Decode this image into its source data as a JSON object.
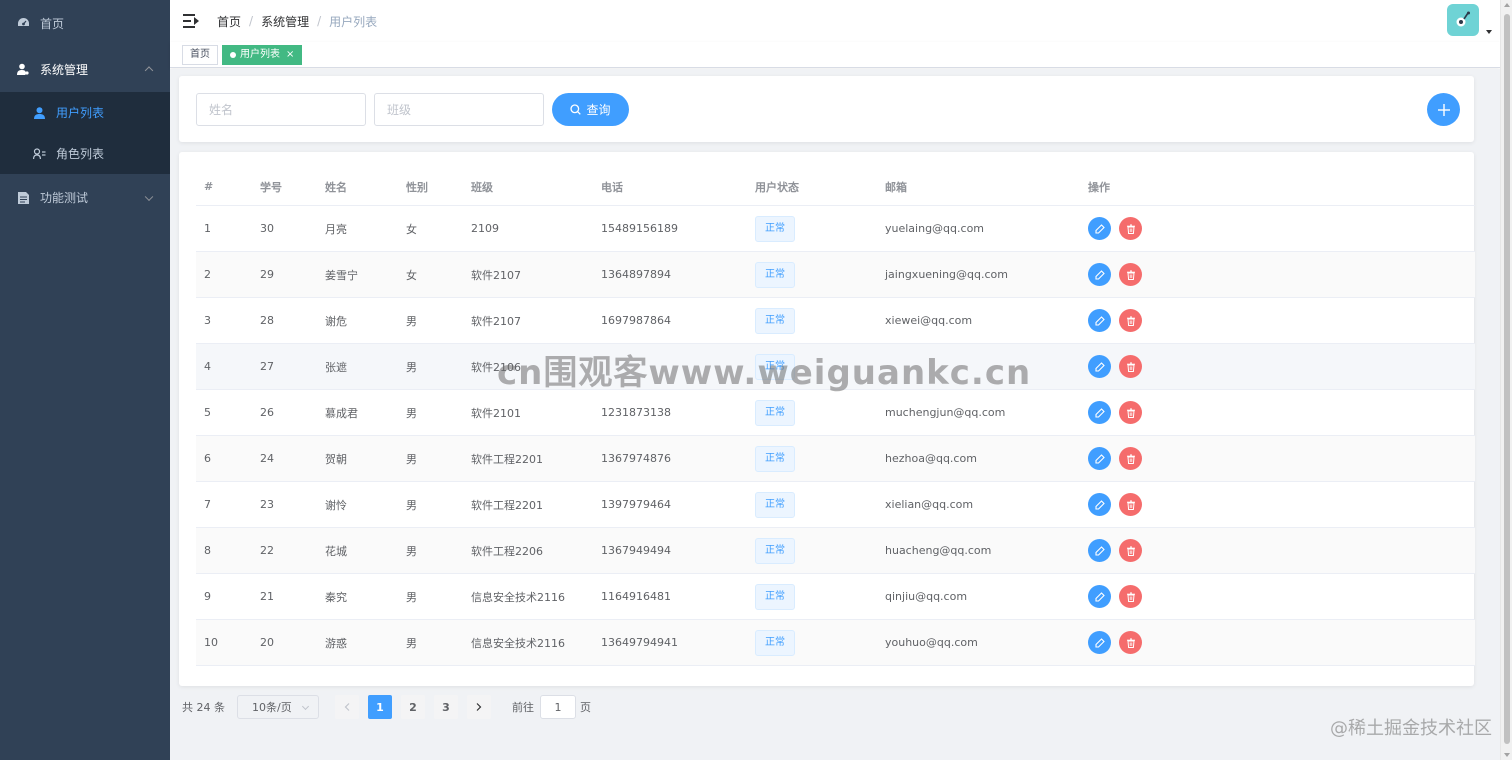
{
  "sidebar": {
    "items": [
      {
        "label": "首页",
        "icon": "dashboard-icon"
      },
      {
        "label": "系统管理",
        "icon": "user-settings-icon",
        "expanded": true,
        "children": [
          {
            "label": "用户列表",
            "icon": "user-icon",
            "active": true
          },
          {
            "label": "角色列表",
            "icon": "role-icon"
          }
        ]
      },
      {
        "label": "功能测试",
        "icon": "document-icon",
        "expanded": false
      }
    ]
  },
  "header": {
    "breadcrumb": [
      "首页",
      "系统管理",
      "用户列表"
    ]
  },
  "tags": {
    "home": "首页",
    "active": "用户列表",
    "close": "×"
  },
  "search": {
    "name_placeholder": "姓名",
    "class_placeholder": "班级",
    "query_label": "查询"
  },
  "table": {
    "columns": [
      "#",
      "学号",
      "姓名",
      "性别",
      "班级",
      "电话",
      "用户状态",
      "邮箱",
      "操作"
    ],
    "rows": [
      {
        "idx": "1",
        "sid": "30",
        "name": "月亮",
        "gender": "女",
        "class": "2109",
        "phone": "15489156189",
        "status": "正常",
        "email": "yuelaing@qq.com"
      },
      {
        "idx": "2",
        "sid": "29",
        "name": "姜雪宁",
        "gender": "女",
        "class": "软件2107",
        "phone": "1364897894",
        "status": "正常",
        "email": "jaingxuening@qq.com"
      },
      {
        "idx": "3",
        "sid": "28",
        "name": "谢危",
        "gender": "男",
        "class": "软件2107",
        "phone": "1697987864",
        "status": "正常",
        "email": "xiewei@qq.com"
      },
      {
        "idx": "4",
        "sid": "27",
        "name": "张遮",
        "gender": "男",
        "class": "软件2106",
        "phone": "",
        "status": "正常",
        "email": ""
      },
      {
        "idx": "5",
        "sid": "26",
        "name": "慕成君",
        "gender": "男",
        "class": "软件2101",
        "phone": "1231873138",
        "status": "正常",
        "email": "muchengjun@qq.com"
      },
      {
        "idx": "6",
        "sid": "24",
        "name": "贺朝",
        "gender": "男",
        "class": "软件工程2201",
        "phone": "1367974876",
        "status": "正常",
        "email": "hezhoa@qq.com"
      },
      {
        "idx": "7",
        "sid": "23",
        "name": "谢怜",
        "gender": "男",
        "class": "软件工程2201",
        "phone": "1397979464",
        "status": "正常",
        "email": "xielian@qq.com"
      },
      {
        "idx": "8",
        "sid": "22",
        "name": "花城",
        "gender": "男",
        "class": "软件工程2206",
        "phone": "1367949494",
        "status": "正常",
        "email": "huacheng@qq.com"
      },
      {
        "idx": "9",
        "sid": "21",
        "name": "秦究",
        "gender": "男",
        "class": "信息安全技术2116",
        "phone": "1164916481",
        "status": "正常",
        "email": "qinjiu@qq.com"
      },
      {
        "idx": "10",
        "sid": "20",
        "name": "游惑",
        "gender": "男",
        "class": "信息安全技术2116",
        "phone": "13649794941",
        "status": "正常",
        "email": "youhuo@qq.com"
      }
    ]
  },
  "pagination": {
    "total": "共 24 条",
    "page_size": "10条/页",
    "pages": [
      "1",
      "2",
      "3"
    ],
    "current": "1",
    "goto_prefix": "前往",
    "goto_value": "1",
    "goto_suffix": "页"
  },
  "overlay": {
    "watermark": "cn围观客www.weiguankc.cn",
    "credit": "@稀土掘金技术社区"
  },
  "colors": {
    "sidebar_bg": "#304156",
    "primary": "#409eff",
    "danger": "#f56c6c",
    "tag_active": "#42b983"
  }
}
